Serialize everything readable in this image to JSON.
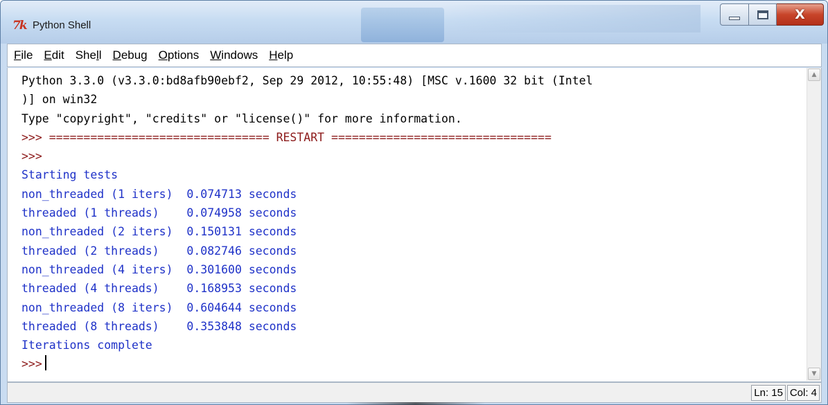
{
  "window": {
    "title": "Python Shell",
    "app_icon_text": "7k",
    "controls": {
      "minimize": "minimize",
      "maximize": "maximize",
      "close": "X"
    }
  },
  "menubar": {
    "items": [
      {
        "pre": "",
        "u": "F",
        "post": "ile"
      },
      {
        "pre": "",
        "u": "E",
        "post": "dit"
      },
      {
        "pre": "She",
        "u": "l",
        "post": "l"
      },
      {
        "pre": "",
        "u": "D",
        "post": "ebug"
      },
      {
        "pre": "",
        "u": "O",
        "post": "ptions"
      },
      {
        "pre": "",
        "u": "W",
        "post": "indows"
      },
      {
        "pre": "",
        "u": "H",
        "post": "elp"
      }
    ]
  },
  "shell": {
    "lines": [
      "Python 3.3.0 (v3.3.0:bd8afb90ebf2, Sep 29 2012, 10:55:48) [MSC v.1600 32 bit (Intel",
      ")] on win32",
      "Type \"copyright\", \"credits\" or \"license()\" for more information.",
      ">>> ================================ RESTART ================================",
      ">>>",
      "Starting tests",
      "non_threaded (1 iters)  0.074713 seconds",
      "threaded (1 threads)    0.074958 seconds",
      "non_threaded (2 iters)  0.150131 seconds",
      "threaded (2 threads)    0.082746 seconds",
      "non_threaded (4 iters)  0.301600 seconds",
      "threaded (4 threads)    0.168953 seconds",
      "non_threaded (8 iters)  0.604644 seconds",
      "threaded (8 threads)    0.353848 seconds",
      "Iterations complete",
      ">>>"
    ],
    "colors": {
      "text": "#000000",
      "prompt": "#8c1a1a",
      "output": "#1f32c8"
    }
  },
  "status": {
    "line": "Ln: 15",
    "col": "Col: 4"
  }
}
